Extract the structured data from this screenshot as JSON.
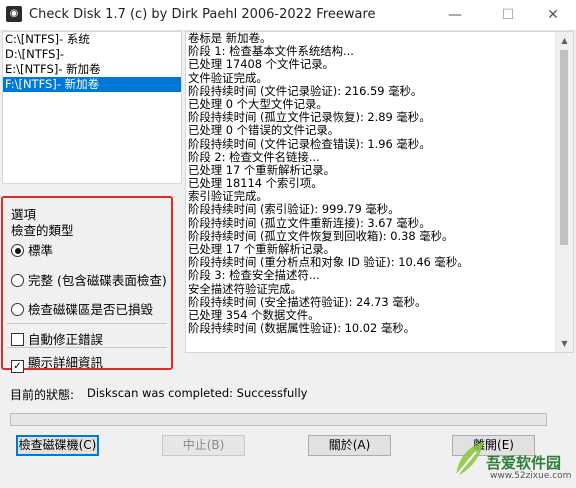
{
  "window": {
    "title": "Check Disk 1.7  (c) by Dirk Paehl  2006-2022 Freeware",
    "icon": "disk-icon",
    "minimize": "—",
    "maximize": "☐",
    "close": "✕"
  },
  "drives": [
    {
      "label": "C:\\[NTFS]- 系统",
      "selected": false
    },
    {
      "label": "D:\\[NTFS]-",
      "selected": false
    },
    {
      "label": "E:\\[NTFS]- 新加卷",
      "selected": false
    },
    {
      "label": "F:\\[NTFS]- 新加卷",
      "selected": true
    }
  ],
  "log": [
    "卷标是 新加卷。",
    "阶段 1: 检查基本文件系统结构...",
    "已处理 17408 个文件记录。",
    "文件验证完成。",
    "阶段持续时间 (文件记录验证): 216.59 毫秒。",
    "已处理 0 个大型文件记录。",
    "阶段持续时间 (孤立文件记录恢复): 2.89 毫秒。",
    "已处理 0 个错误的文件记录。",
    "阶段持续时间 (文件记录检查错误): 1.96 毫秒。",
    "阶段 2: 检查文件名链接...",
    "已处理 17 个重新解析记录。",
    "已处理 18114 个索引项。",
    "索引验证完成。",
    "阶段持续时间 (索引验证): 999.79 毫秒。",
    "阶段持续时间 (孤立文件重新连接): 3.67 毫秒。",
    "阶段持续时间 (孤立文件恢复到回收箱): 0.38 毫秒。",
    "已处理 17 个重新解析记录。",
    "阶段持续时间 (重分析点和对象 ID 验证): 10.46 毫秒。",
    "阶段 3: 检查安全描述符...",
    "安全描述符验证完成。",
    "阶段持续时间 (安全描述符验证): 24.73 毫秒。",
    "已处理 354 个数据文件。",
    "阶段持续时间 (数据属性验证): 10.02 毫秒。"
  ],
  "options": {
    "title": "選項",
    "subtitle": "檢查的類型",
    "radios": [
      {
        "label": "標準",
        "checked": true
      },
      {
        "label": "完整 (包含磁碟表面檢查)",
        "checked": false
      },
      {
        "label": "檢查磁碟區是否已損毀",
        "checked": false
      }
    ],
    "checkboxes": [
      {
        "label": "自動修正錯誤",
        "checked": false
      },
      {
        "label": "顯示詳細資訊",
        "checked": true
      }
    ]
  },
  "status": {
    "label": "目前的狀態:",
    "text": "Diskscan was completed: Successfully"
  },
  "progress": 0,
  "buttons": {
    "check": "檢查磁碟機(C)",
    "stop": "中止(B)",
    "about": "關於(A)",
    "exit": "離開(E)"
  },
  "watermark": {
    "text": "吾爱软件园",
    "url": "www.52zixue.com"
  },
  "colors": {
    "accent": "#0078d7",
    "highlight_border": "#e02b2b",
    "progress_fill": "#06b025"
  }
}
